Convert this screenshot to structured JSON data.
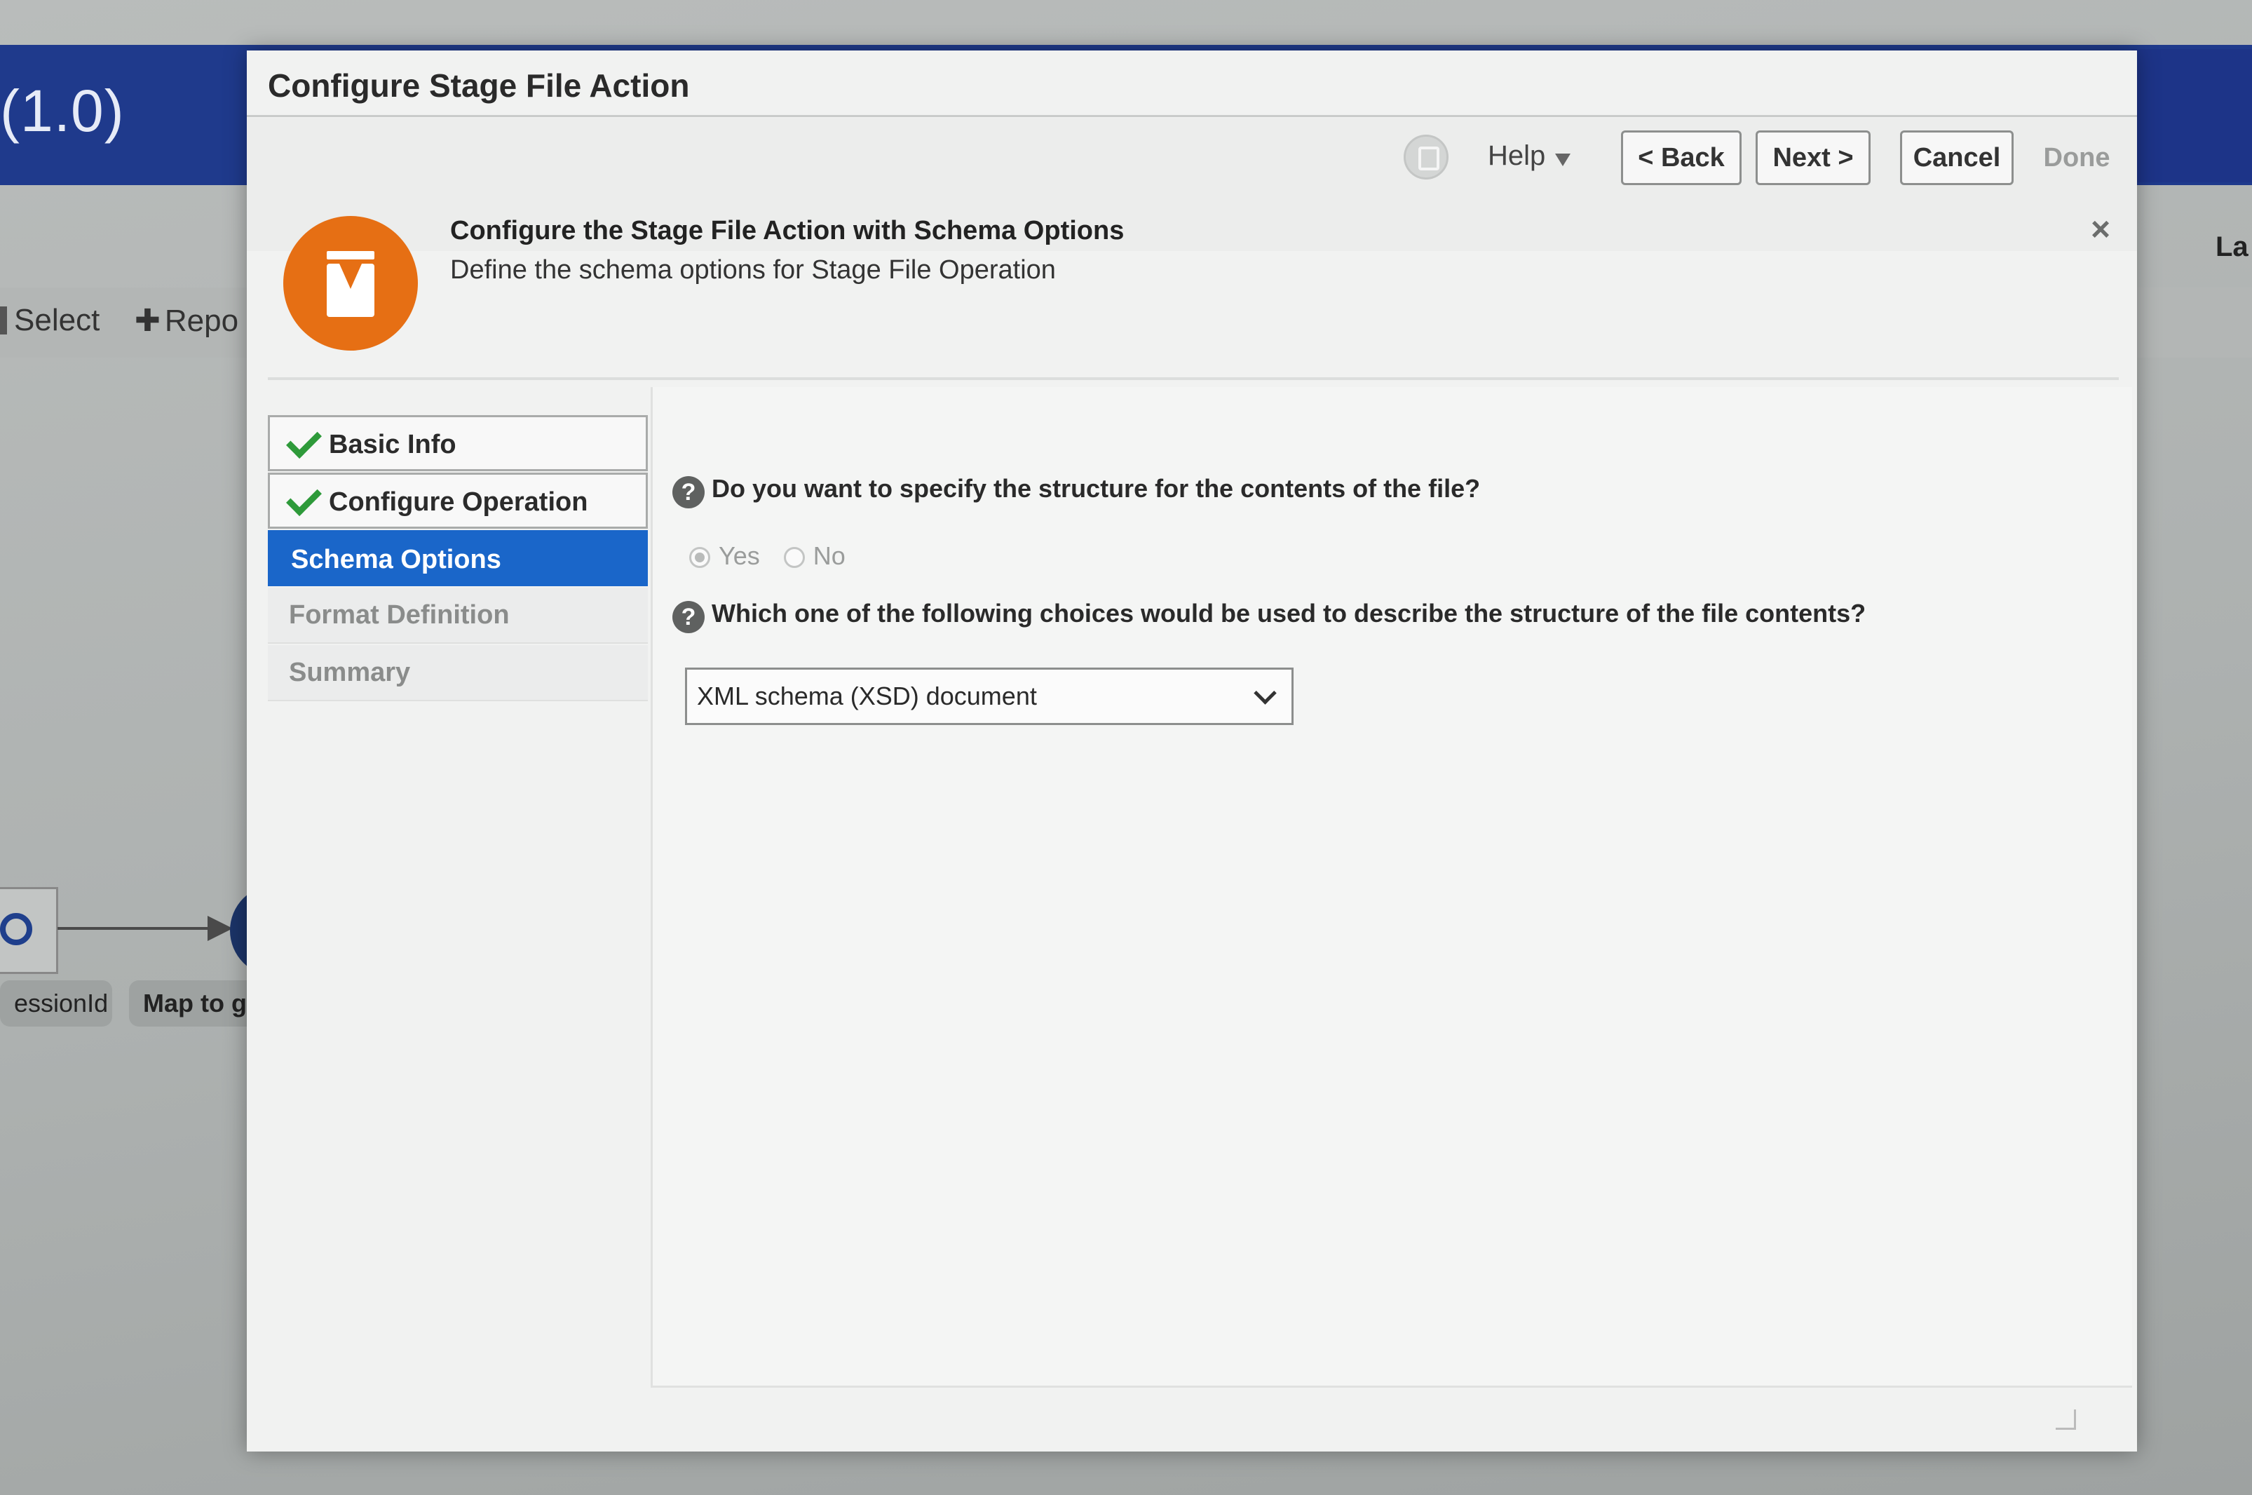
{
  "background": {
    "app_version": "(1.0)",
    "toolbar": {
      "select_label": "Select",
      "repo_label": "Repo"
    },
    "right_label": "La",
    "flow": {
      "pill_1": "essionId",
      "pill_2": "Map to get"
    }
  },
  "dialog": {
    "title": "Configure Stage File Action",
    "toolbar": {
      "help_label": "Help",
      "back_label": "< Back",
      "next_label": "Next >",
      "cancel_label": "Cancel",
      "done_label": "Done"
    },
    "banner": {
      "title": "Configure the Stage File Action with Schema Options",
      "subtitle": "Define the schema options for Stage File Operation",
      "close_label": "×"
    },
    "train": {
      "items": [
        {
          "label": "Basic Info",
          "state": "done"
        },
        {
          "label": "Configure Operation",
          "state": "done"
        },
        {
          "label": "Schema Options",
          "state": "active"
        },
        {
          "label": "Format Definition",
          "state": "pending"
        },
        {
          "label": "Summary",
          "state": "pending"
        }
      ]
    },
    "content": {
      "question_1": "Do you want to specify the structure for the contents of the file?",
      "radio_yes": "Yes",
      "radio_no": "No",
      "selected_radio": "Yes",
      "question_2": "Which one of the following choices would be used to describe the structure of the file contents?",
      "structure_select_value": "XML schema (XSD) document",
      "help_glyph": "?"
    }
  },
  "colors": {
    "header_blue": "#1f3a8c",
    "active_step": "#1a66c9",
    "check_green": "#2e9a3a",
    "orange_icon": "#e66f14"
  }
}
